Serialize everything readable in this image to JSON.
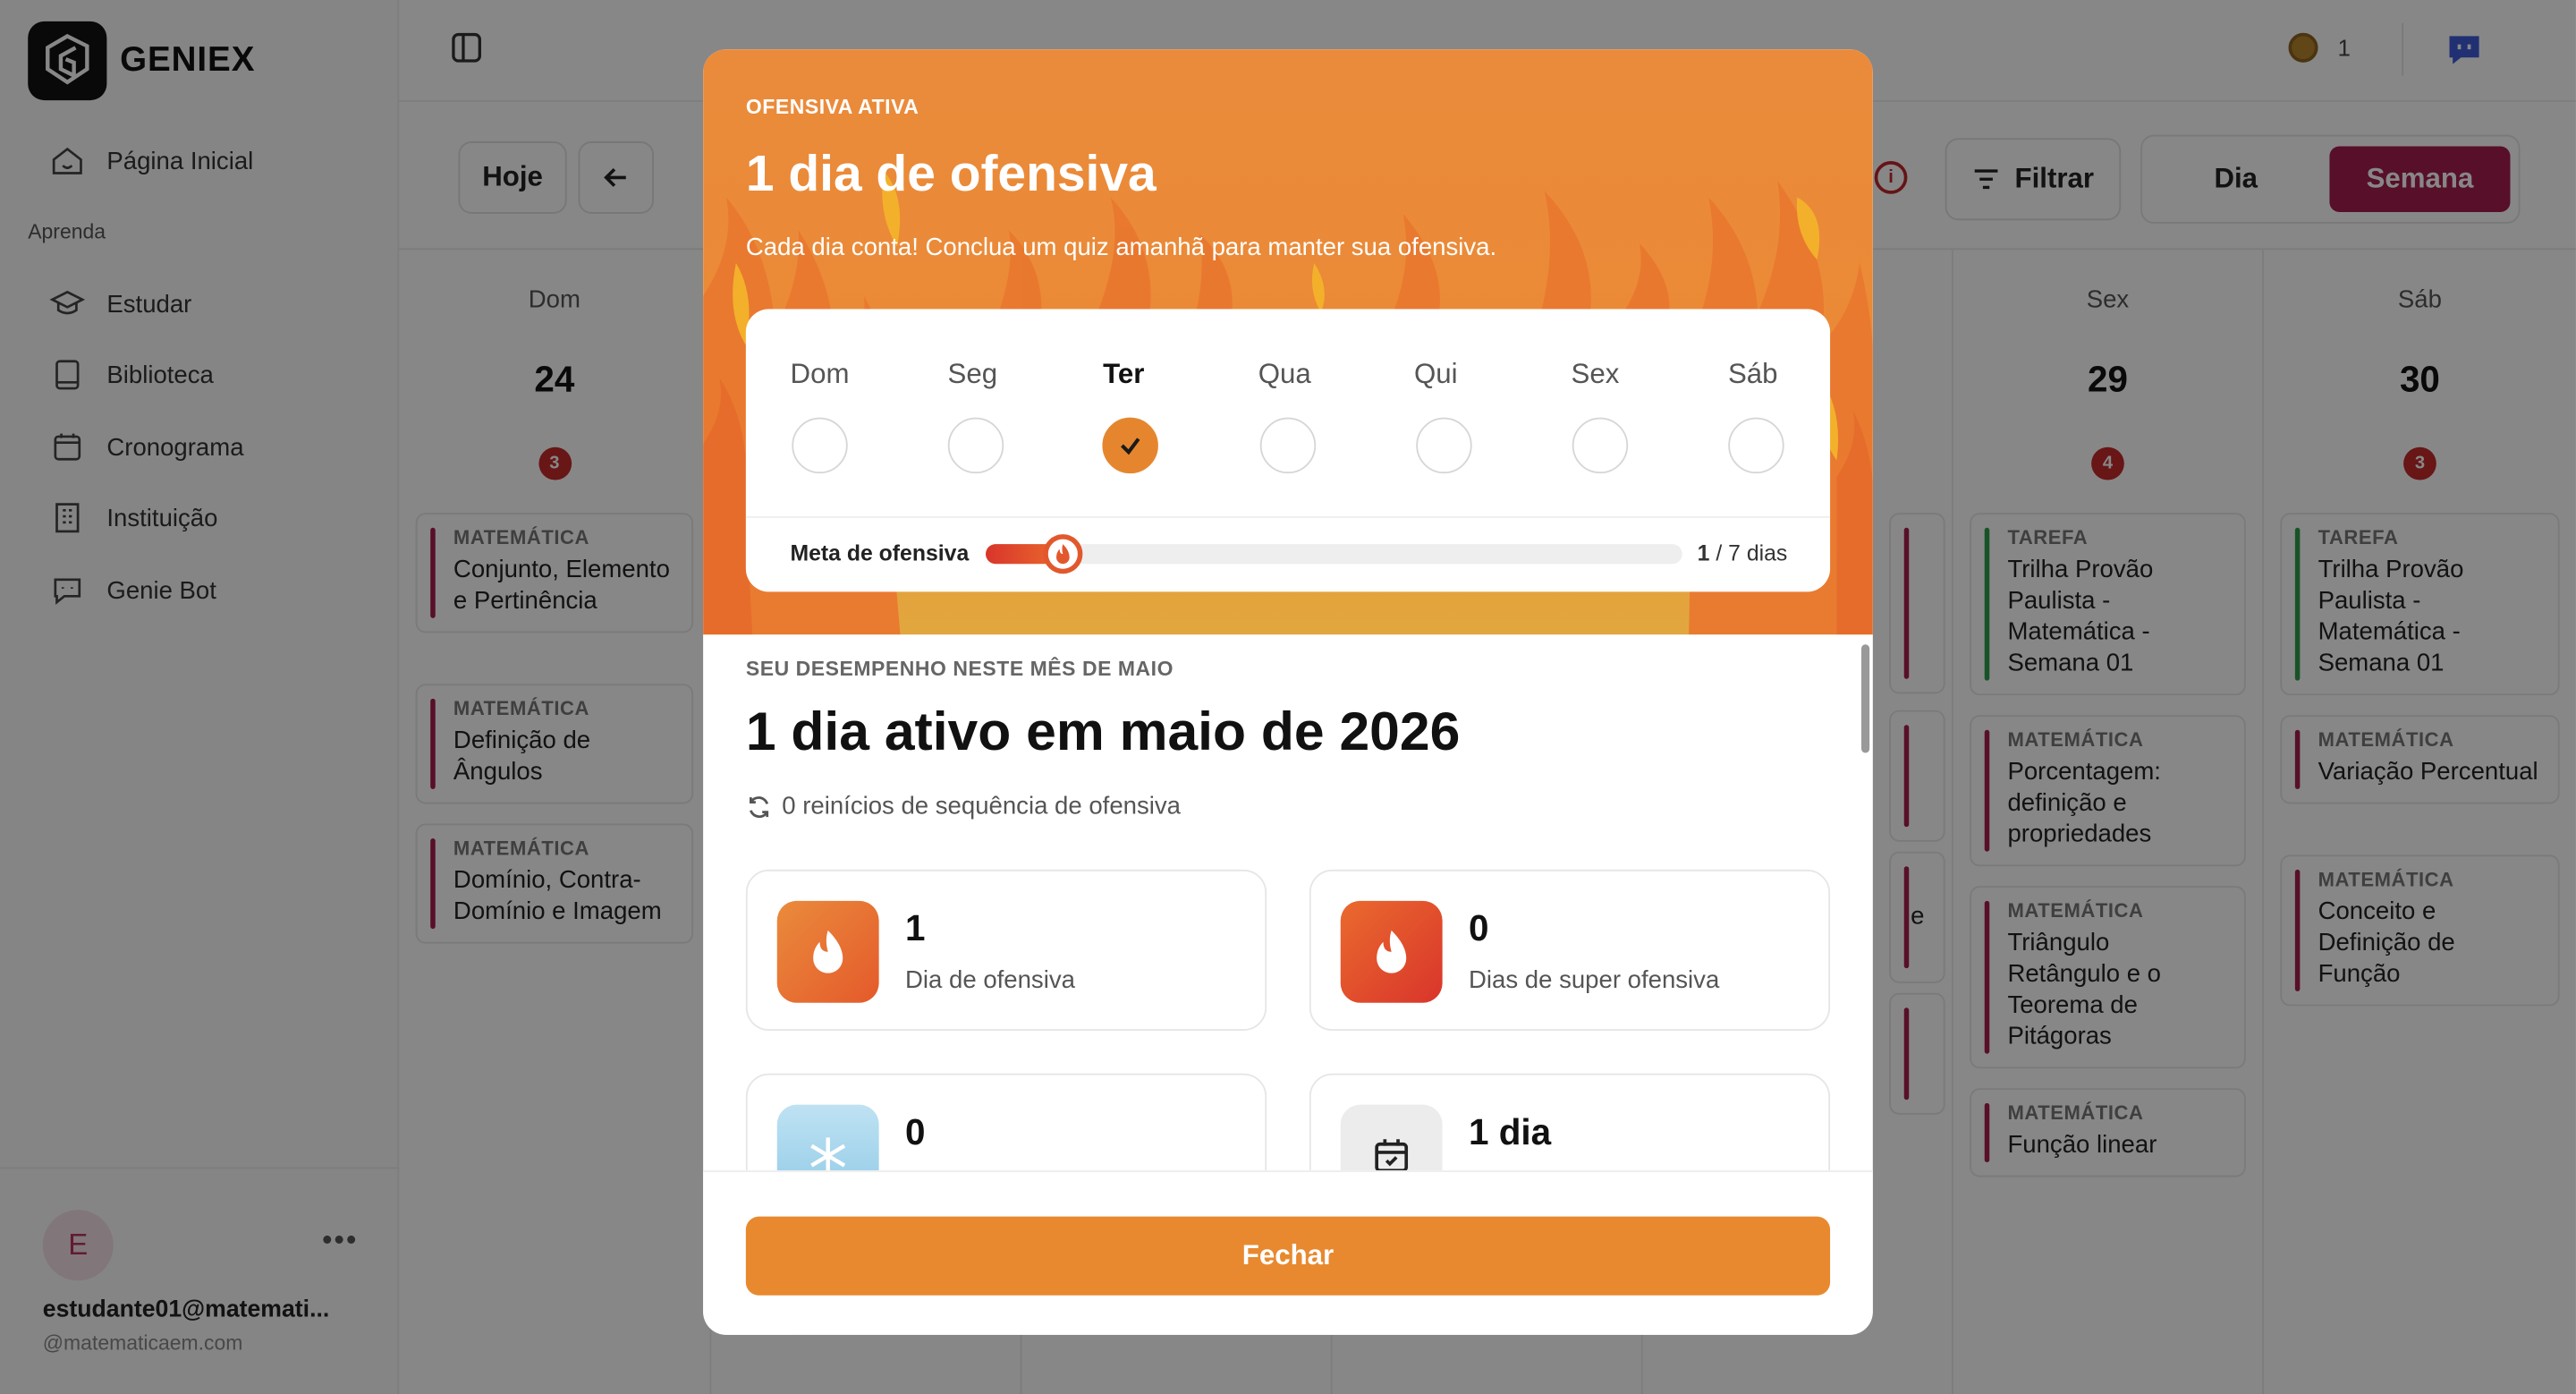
{
  "app": {
    "brand": "GENIEX"
  },
  "sidebar": {
    "items": [
      {
        "label": "Página Inicial",
        "icon": "home-icon"
      },
      {
        "label": "Estudar",
        "icon": "graduation-cap-icon"
      },
      {
        "label": "Biblioteca",
        "icon": "book-icon"
      },
      {
        "label": "Cronograma",
        "icon": "calendar-icon"
      },
      {
        "label": "Instituição",
        "icon": "building-icon"
      },
      {
        "label": "Genie Bot",
        "icon": "chat-bot-icon"
      }
    ],
    "section_label": "Aprenda",
    "user": {
      "initial": "E",
      "email": "estudante01@matemati...",
      "domain": "@matematicaem.com"
    }
  },
  "topbar": {
    "coins": "1"
  },
  "toolbar": {
    "today": "Hoje",
    "filter": "Filtrar",
    "view_day": "Dia",
    "view_week": "Semana"
  },
  "calendar": {
    "days": [
      {
        "name": "Dom",
        "num": "24",
        "count": "3",
        "cards": [
          {
            "kind": "MATEMÁTICA",
            "title": "Conjunto, Elemento e Pertinência"
          },
          {
            "kind": "MATEMÁTICA",
            "title": "Definição de Ângulos"
          },
          {
            "kind": "MATEMÁTICA",
            "title": "Domínio, Contra-Domínio e Imagem"
          }
        ]
      },
      {
        "name": "Sex",
        "num": "29",
        "count": "4",
        "cards": [
          {
            "kind": "TAREFA",
            "title": "Trilha Provão Paulista - Matemática - Semana 01"
          },
          {
            "kind": "MATEMÁTICA",
            "title": "Porcentagem: definição e propriedades"
          },
          {
            "kind": "MATEMÁTICA",
            "title": "Triângulo Retângulo e o Teorema de Pitágoras"
          },
          {
            "kind": "MATEMÁTICA",
            "title": "Função linear"
          }
        ]
      },
      {
        "name": "Sáb",
        "num": "30",
        "count": "3",
        "cards": [
          {
            "kind": "TAREFA",
            "title": "Trilha Provão Paulista - Matemática - Semana 01"
          },
          {
            "kind": "MATEMÁTICA",
            "title": "Variação Percentual"
          },
          {
            "kind": "MATEMÁTICA",
            "title": "Conceito e Definição de Função"
          }
        ]
      }
    ],
    "partial_text": "e"
  },
  "modal": {
    "kicker": "OFENSIVA ATIVA",
    "title": "1 dia de ofensiva",
    "subtitle": "Cada dia conta! Conclua um quiz amanhã para manter sua ofensiva.",
    "week": [
      {
        "label": "Dom",
        "done": false
      },
      {
        "label": "Seg",
        "done": false
      },
      {
        "label": "Ter",
        "done": true
      },
      {
        "label": "Qua",
        "done": false
      },
      {
        "label": "Qui",
        "done": false
      },
      {
        "label": "Sex",
        "done": false
      },
      {
        "label": "Sáb",
        "done": false
      }
    ],
    "goal": {
      "label": "Meta de ofensiva",
      "current": "1",
      "rest": " / 7 dias",
      "progress": 0.11
    },
    "perf_kicker": "SEU DESEMPENHO NESTE MÊS DE MAIO",
    "perf_title": "1 dia ativo em maio de 2026",
    "perf_resets": "0 reinícios de sequência de ofensiva",
    "stats": [
      {
        "value": "1",
        "label": "Dia de ofensiva",
        "icon": "flame-icon"
      },
      {
        "value": "0",
        "label": "Dias de super ofensiva",
        "icon": "flame-icon"
      },
      {
        "value": "0",
        "label": "",
        "icon": "snowflake-icon"
      },
      {
        "value": "1 dia",
        "label": "",
        "icon": "calendar-check-icon"
      }
    ],
    "close": "Fechar"
  },
  "colors": {
    "accent": "#a61d4e",
    "orange": "#e8892f"
  }
}
